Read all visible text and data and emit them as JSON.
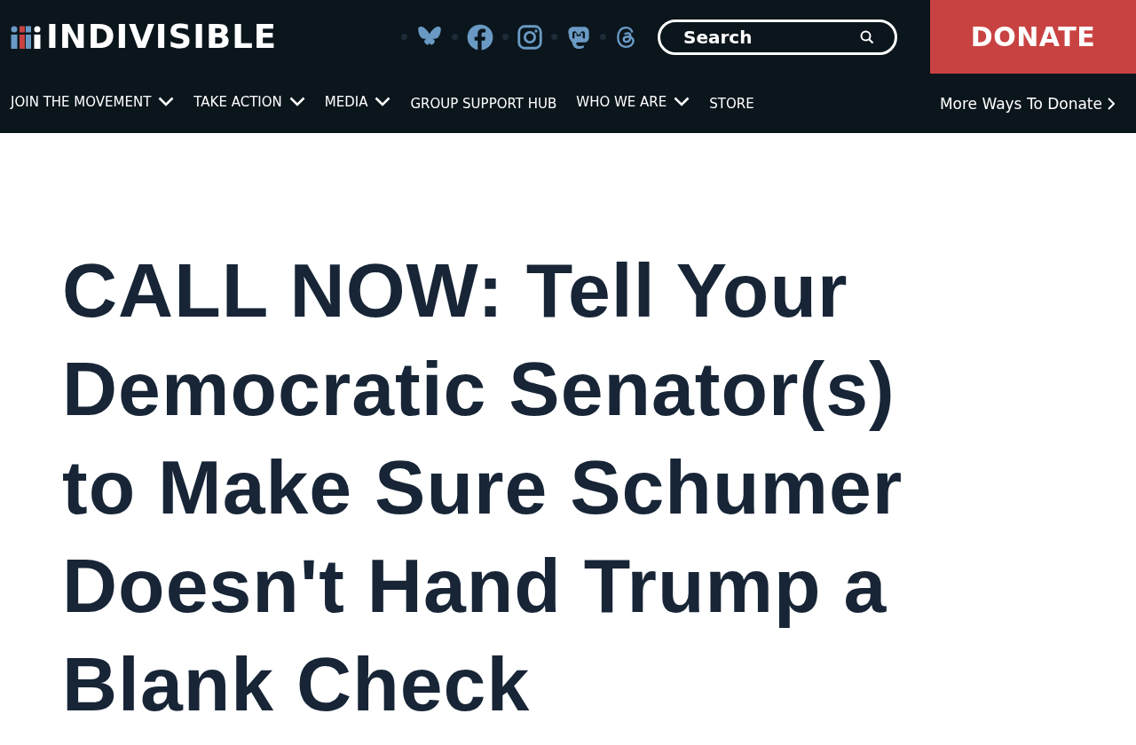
{
  "header": {
    "logo": "INDIVISIBLE",
    "social_links": [
      {
        "kind": "bluesky"
      },
      {
        "kind": "facebook"
      },
      {
        "kind": "instagram"
      },
      {
        "kind": "mastodon"
      },
      {
        "kind": "threads"
      }
    ],
    "search": {
      "placeholder": "Search"
    },
    "donate_button": "DONATE"
  },
  "nav": {
    "items": [
      {
        "label": "JOIN THE MOVEMENT",
        "has_dropdown": true
      },
      {
        "label": "TAKE ACTION",
        "has_dropdown": true
      },
      {
        "label": "MEDIA",
        "has_dropdown": true
      },
      {
        "label": "GROUP SUPPORT HUB",
        "has_dropdown": false
      },
      {
        "label": "WHO WE ARE",
        "has_dropdown": true
      },
      {
        "label": "STORE",
        "has_dropdown": false
      }
    ],
    "more_link": "More Ways To Donate"
  },
  "headline": "CALL NOW: Tell Your Democratic Senator(s) to Make Sure Schumer Doesn't Hand Trump a Blank Check"
}
